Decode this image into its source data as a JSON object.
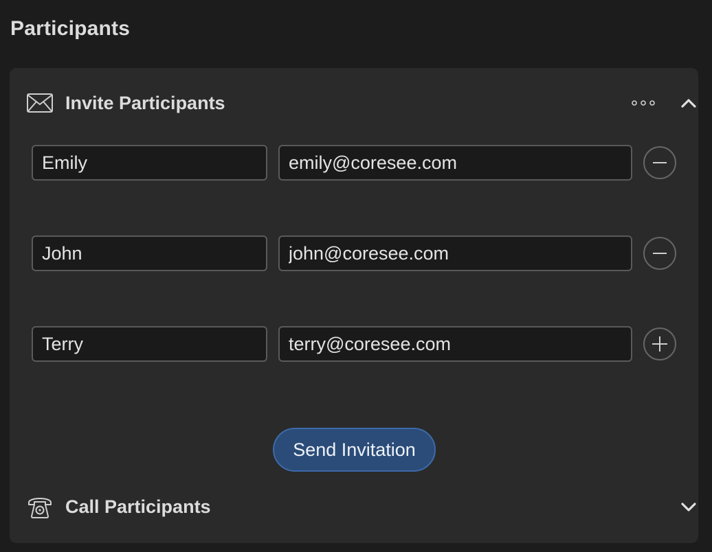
{
  "page": {
    "title": "Participants"
  },
  "invite": {
    "title": "Invite Participants",
    "icon": "envelope-icon",
    "participants": [
      {
        "name": "Emily",
        "email": "emily@coresee.com",
        "action": "remove"
      },
      {
        "name": "John",
        "email": "john@coresee.com",
        "action": "remove"
      },
      {
        "name": "Terry",
        "email": "terry@coresee.com",
        "action": "add"
      }
    ],
    "send_label": "Send Invitation"
  },
  "call": {
    "title": "Call Participants",
    "icon": "telephone-icon"
  },
  "colors": {
    "background": "#1c1c1c",
    "panel": "#2a2a2a",
    "input_bg": "#1a1a1a",
    "input_border": "#5a5a5a",
    "button_bg": "#2b4c78",
    "button_border": "#3d6aaa"
  }
}
